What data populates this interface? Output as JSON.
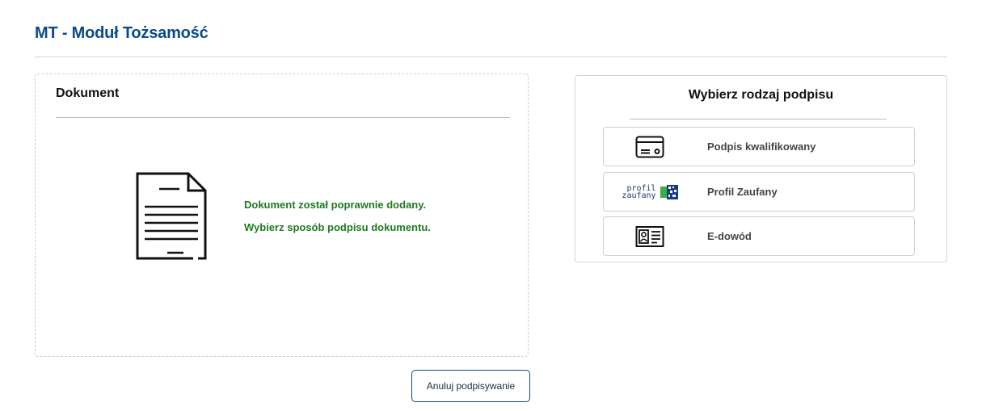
{
  "page": {
    "title": "MT - Moduł Tożsamość"
  },
  "document_panel": {
    "title": "Dokument",
    "icon": "document-icon",
    "message_line1": "Dokument został poprawnie dodany.",
    "message_line2": "Wybierz sposób podpisu dokumentu.",
    "message_color": "#1f7a1f"
  },
  "actions": {
    "cancel_label": "Anuluj podpisywanie"
  },
  "signature_panel": {
    "title": "Wybierz rodzaj podpisu",
    "options": [
      {
        "label": "Podpis kwalifikowany",
        "icon": "card-reader-icon"
      },
      {
        "label": "Profil Zaufany",
        "icon": "profil-zaufany-logo",
        "logo_text_top": "profil",
        "logo_text_bottom": "zaufany"
      },
      {
        "label": "E-dowód",
        "icon": "id-card-icon"
      }
    ]
  },
  "colors": {
    "brand": "#0a4a8a",
    "success": "#1f7a1f"
  }
}
